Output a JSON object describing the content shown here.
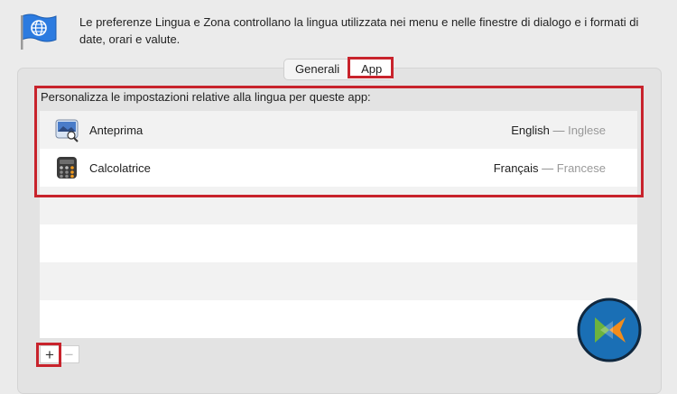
{
  "header": {
    "description": "Le preferenze Lingua e Zona controllano la lingua utilizzata nei menu e nelle finestre di dialogo e i formati di date, orari e valute.",
    "icon": "globe-flag-icon"
  },
  "tabs": [
    {
      "label": "Generali",
      "active": false
    },
    {
      "label": "App",
      "active": true
    }
  ],
  "apps_section": {
    "label": "Personalizza le impostazioni relative alla lingua per queste app:",
    "rows": [
      {
        "name": "Anteprima",
        "icon": "preview-app-icon",
        "language": "English",
        "language_native": "Inglese"
      },
      {
        "name": "Calcolatrice",
        "icon": "calculator-app-icon",
        "language": "Français",
        "language_native": "Francese"
      }
    ]
  },
  "buttons": {
    "add": "+",
    "remove": "−"
  },
  "colors": {
    "highlight": "#c8232c",
    "background": "#ebebeb"
  }
}
